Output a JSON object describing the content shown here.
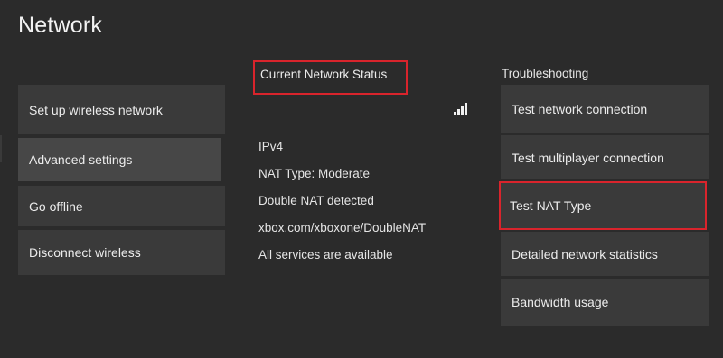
{
  "page": {
    "title": "Network"
  },
  "left_menu": {
    "items": [
      {
        "label": "Set up wireless network"
      },
      {
        "label": "Advanced settings"
      },
      {
        "label": "Go offline"
      },
      {
        "label": "Disconnect wireless"
      }
    ]
  },
  "status": {
    "heading": "Current Network Status",
    "signal_icon": "wifi-signal-bars-icon",
    "lines": [
      "IPv4",
      "NAT Type: Moderate",
      "Double NAT detected",
      "xbox.com/xboxone/DoubleNAT",
      "All services are available"
    ]
  },
  "troubleshooting": {
    "heading": "Troubleshooting",
    "items": [
      {
        "label": "Test network connection"
      },
      {
        "label": "Test multiplayer connection"
      },
      {
        "label": "Test NAT Type"
      },
      {
        "label": "Detailed network statistics"
      },
      {
        "label": "Bandwidth usage"
      }
    ]
  },
  "colors": {
    "background": "#2b2b2b",
    "tile": "#3a3a3a",
    "tile_focused": "#474747",
    "highlight": "#d9242c",
    "text": "#e8e8e8"
  }
}
